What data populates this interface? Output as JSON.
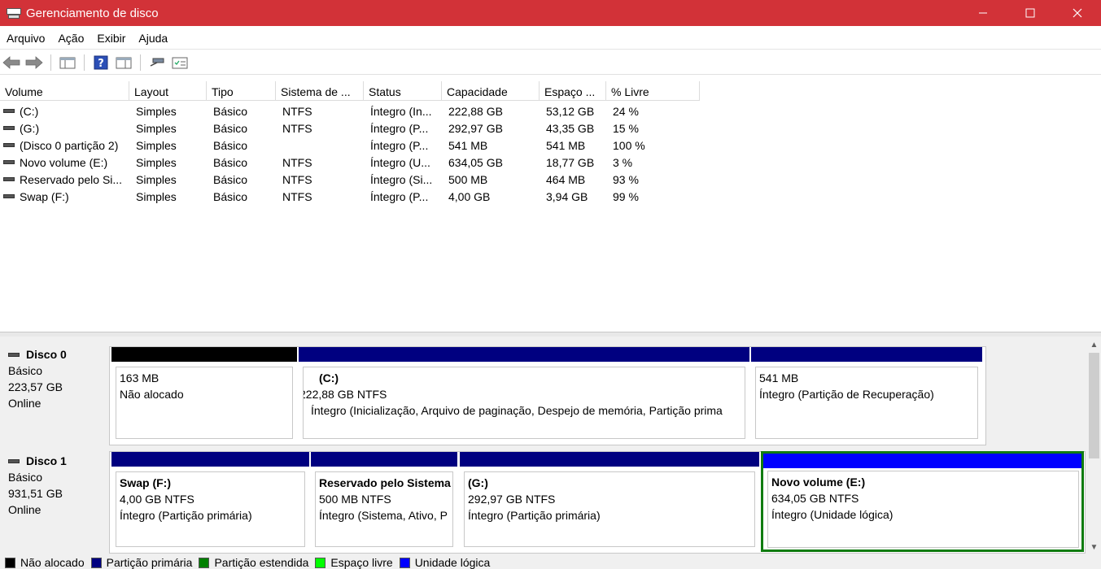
{
  "window": {
    "title": "Gerenciamento de disco",
    "controls": {
      "minimize": "—",
      "maximize": "☐",
      "close": "✕"
    }
  },
  "menu": [
    "Arquivo",
    "Ação",
    "Exibir",
    "Ajuda"
  ],
  "toolbar": {
    "buttons": [
      "back-arrow-icon",
      "forward-arrow-icon",
      "console-tree-icon",
      "help-icon",
      "properties-icon",
      "connect-icon",
      "settings-icon"
    ]
  },
  "columns": [
    "Volume",
    "Layout",
    "Tipo",
    "Sistema de ...",
    "Status",
    "Capacidade",
    "Espaço ...",
    "% Livre"
  ],
  "volumes": [
    [
      "(C:)",
      "Simples",
      "Básico",
      "NTFS",
      "Íntegro (In...",
      "222,88 GB",
      "53,12 GB",
      "24 %"
    ],
    [
      "(G:)",
      "Simples",
      "Básico",
      "NTFS",
      "Íntegro (P...",
      "292,97 GB",
      "43,35 GB",
      "15 %"
    ],
    [
      "(Disco 0 partição 2)",
      "Simples",
      "Básico",
      "",
      "Íntegro (P...",
      "541 MB",
      "541 MB",
      "100 %"
    ],
    [
      "Novo volume (E:)",
      "Simples",
      "Básico",
      "NTFS",
      "Íntegro (U...",
      "634,05 GB",
      "18,77 GB",
      "3 %"
    ],
    [
      "Reservado pelo Si...",
      "Simples",
      "Básico",
      "NTFS",
      "Íntegro (Si...",
      "500 MB",
      "464 MB",
      "93 %"
    ],
    [
      "Swap (F:)",
      "Simples",
      "Básico",
      "NTFS",
      "Íntegro (P...",
      "4,00 GB",
      "3,94 GB",
      "99 %"
    ]
  ],
  "disks": [
    {
      "name": "Disco 0",
      "type": "Básico",
      "size": "223,57 GB",
      "state": "Online",
      "partitions": [
        {
          "name": "",
          "size": "163 MB",
          "status": "Não alocado",
          "bar": "black"
        },
        {
          "name": "(C:)",
          "size": "222,88 GB NTFS",
          "status": "Íntegro (Inicialização, Arquivo de paginação, Despejo de memória, Partição prima",
          "bar": "navy"
        },
        {
          "name": "",
          "size": "541 MB",
          "status": "Íntegro (Partição de Recuperação)",
          "bar": "navy"
        }
      ]
    },
    {
      "name": "Disco 1",
      "type": "Básico",
      "size": "931,51 GB",
      "state": "Online",
      "partitions": [
        {
          "name": "Swap  (F:)",
          "size": "4,00 GB NTFS",
          "status": "Íntegro (Partição primária)",
          "bar": "navy"
        },
        {
          "name": "Reservado pelo Sistema",
          "size": "500 MB NTFS",
          "status": "Íntegro (Sistema, Ativo, P",
          "bar": "navy"
        },
        {
          "name": "(G:)",
          "size": "292,97 GB NTFS",
          "status": "Íntegro (Partição primária)",
          "bar": "navy"
        },
        {
          "name": "Novo volume  (E:)",
          "size": "634,05 GB NTFS",
          "status": "Íntegro (Unidade lógica)",
          "bar": "blue"
        }
      ]
    }
  ],
  "legend": [
    {
      "label": "Não alocado",
      "color": "#000000"
    },
    {
      "label": "Partição primária",
      "color": "#000080"
    },
    {
      "label": "Partição estendida",
      "color": "#008000"
    },
    {
      "label": "Espaço livre",
      "color": "#00ff00"
    },
    {
      "label": "Unidade lógica",
      "color": "#0000ff"
    }
  ],
  "colors": {
    "titlebar": "#d23238",
    "selection": "#107c10"
  }
}
